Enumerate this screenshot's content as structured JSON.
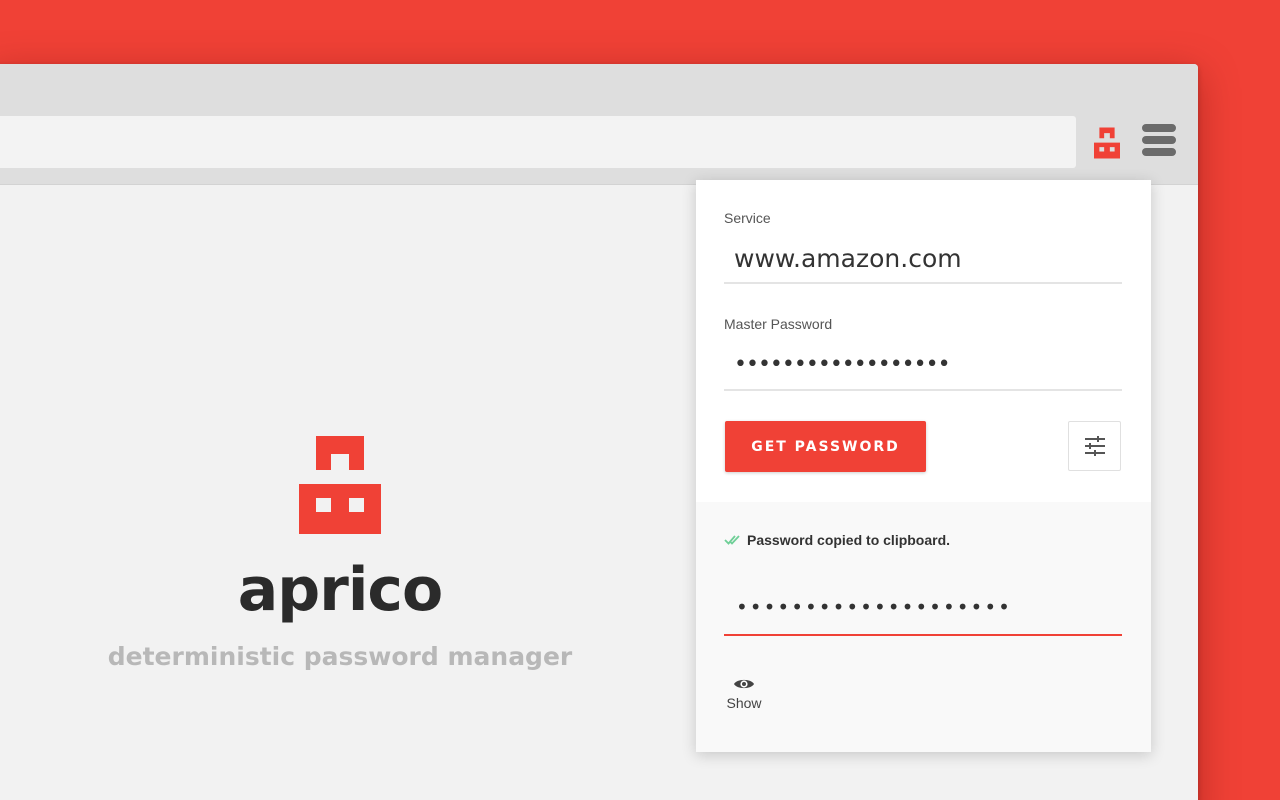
{
  "colors": {
    "accent": "#f04136",
    "background": "#f04136",
    "text_dark": "#2b2b2b",
    "text_muted": "#b8b8b8",
    "success": "#6fcf97"
  },
  "browser": {
    "extension_icon": "aprico-logo-icon",
    "menu_icon": "hamburger-menu-icon"
  },
  "branding": {
    "logo_icon": "aprico-logo-icon",
    "name": "aprico",
    "tagline": "deterministic password manager"
  },
  "popup": {
    "service": {
      "label": "Service",
      "value": "www.amazon.com"
    },
    "master_password": {
      "label": "Master Password",
      "value": "••••••••••••••••••"
    },
    "get_password_button": "GET PASSWORD",
    "settings_icon": "sliders-icon",
    "result": {
      "status_icon": "double-check-icon",
      "status_text": "Password copied to clipboard.",
      "password_value": "••••••••••••••••••••",
      "show_icon": "eye-icon",
      "show_label": "Show"
    }
  }
}
